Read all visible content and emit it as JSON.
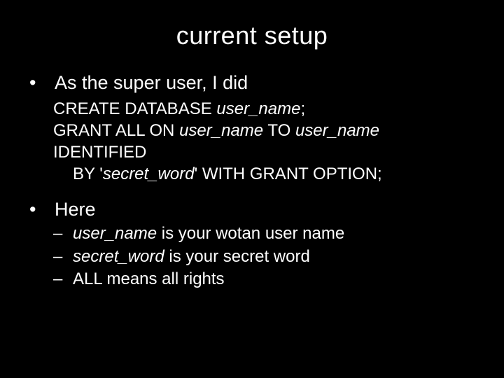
{
  "slide": {
    "title": "current setup",
    "items": [
      {
        "label": "As the super user, I did",
        "sql": {
          "l1a": "CREATE DATABASE ",
          "l1b": "user_name",
          "l1c": ";",
          "l2a": "GRANT ALL ON ",
          "l2b": "user_name",
          "l2c": " TO ",
          "l2d": "user_name",
          "l2e": " IDENTIFIED",
          "l3a": "BY '",
          "l3b": "secret_word",
          "l3c": "' WITH GRANT OPTION;"
        }
      },
      {
        "label": "Here",
        "subs": [
          {
            "term": "user_name",
            "rest": "  is your wotan user name"
          },
          {
            "term": "secret_word",
            "rest": "  is your secret word"
          },
          {
            "term": "",
            "rest": "ALL means all rights"
          }
        ]
      }
    ]
  },
  "glyphs": {
    "dot": "•",
    "dash": "–"
  }
}
